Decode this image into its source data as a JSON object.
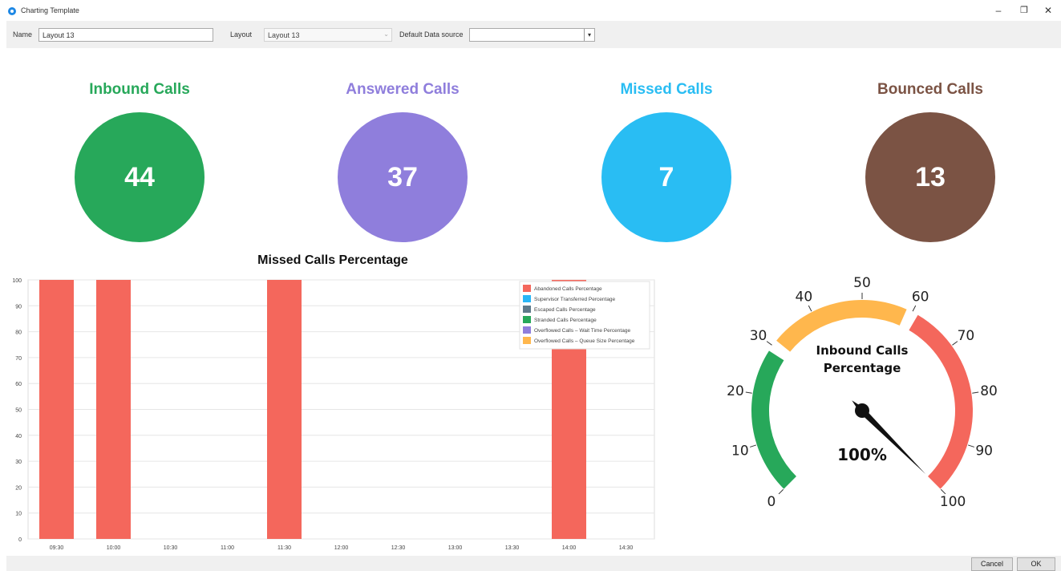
{
  "window": {
    "title": "Charting Template",
    "min_glyph": "–",
    "max_glyph": "❐",
    "close_glyph": "✕"
  },
  "toolbar": {
    "name_label": "Name",
    "name_value": "Layout 13",
    "layout_label": "Layout",
    "layout_value": "Layout 13",
    "datasource_label": "Default Data source",
    "datasource_value": ""
  },
  "kpis": [
    {
      "title": "Inbound Calls",
      "value": "44",
      "color": "#27a85a"
    },
    {
      "title": "Answered Calls",
      "value": "37",
      "color": "#8f7edc"
    },
    {
      "title": "Missed Calls",
      "value": "7",
      "color": "#29bdf3"
    },
    {
      "title": "Bounced Calls",
      "value": "13",
      "color": "#7b5344"
    }
  ],
  "chart_data": [
    {
      "type": "bar",
      "title": "Missed Calls Percentage",
      "categories": [
        "09:30",
        "10:00",
        "10:30",
        "11:00",
        "11:30",
        "12:00",
        "12:30",
        "13:00",
        "13:30",
        "14:00",
        "14:30"
      ],
      "series": [
        {
          "name": "Abandoned Calls Percentage",
          "color": "#f4675c",
          "values": [
            100,
            100,
            0,
            0,
            100,
            0,
            0,
            0,
            0,
            100,
            0
          ]
        },
        {
          "name": "Supervisor Transferred Percentage",
          "color": "#29b6f6",
          "values": [
            0,
            0,
            0,
            0,
            0,
            0,
            0,
            0,
            0,
            0,
            0
          ]
        },
        {
          "name": "Escaped Calls Percentage",
          "color": "#5f7a8a",
          "values": [
            0,
            0,
            0,
            0,
            0,
            0,
            0,
            0,
            0,
            0,
            0
          ]
        },
        {
          "name": "Stranded Calls Percentage",
          "color": "#27a85a",
          "values": [
            0,
            0,
            0,
            0,
            0,
            0,
            0,
            0,
            0,
            0,
            0
          ]
        },
        {
          "name": "Overflowed Calls – Wait Time Percentage",
          "color": "#8f7edc",
          "values": [
            0,
            0,
            0,
            0,
            0,
            0,
            0,
            0,
            0,
            0,
            0
          ]
        },
        {
          "name": "Overflowed Calls – Queue Size Percentage",
          "color": "#ffb74d",
          "values": [
            0,
            0,
            0,
            0,
            0,
            0,
            0,
            0,
            0,
            0,
            0
          ]
        }
      ],
      "yticks": [
        0,
        10,
        20,
        30,
        40,
        50,
        60,
        70,
        80,
        90,
        100
      ],
      "ylim": [
        0,
        100
      ],
      "grid": true,
      "legend": "top-right"
    },
    {
      "type": "gauge",
      "title": "Inbound Calls Percentage",
      "value": 100,
      "value_label": "100%",
      "min": 0,
      "max": 100,
      "ticks": [
        0,
        10,
        20,
        30,
        40,
        50,
        60,
        70,
        80,
        90,
        100
      ],
      "bands": [
        {
          "from": 0,
          "to": 30,
          "color": "#27a85a"
        },
        {
          "from": 30,
          "to": 60,
          "color": "#ffb74d"
        },
        {
          "from": 60,
          "to": 100,
          "color": "#f4675c"
        }
      ]
    }
  ],
  "buttons": {
    "cancel": "Cancel",
    "ok": "OK"
  }
}
